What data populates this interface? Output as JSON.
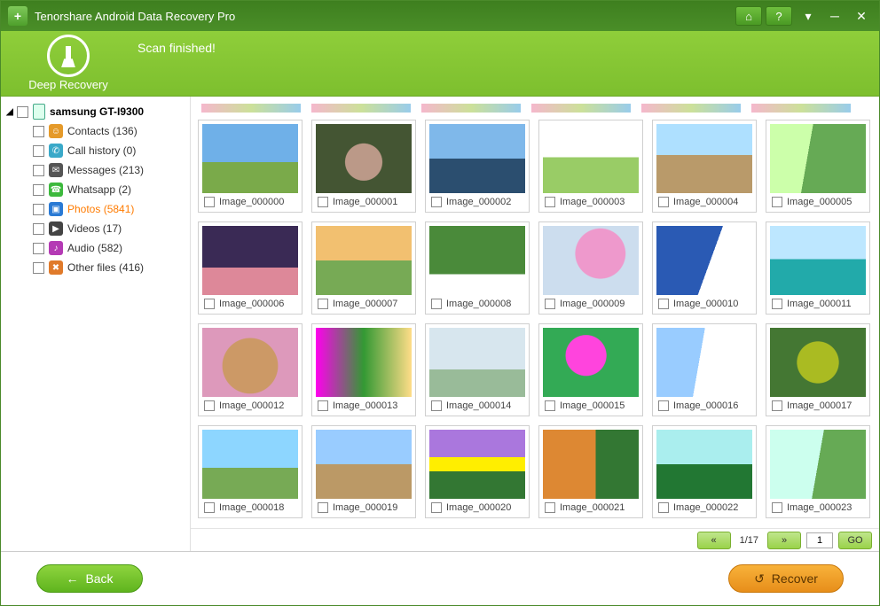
{
  "titlebar": {
    "app_title": "Tenorshare Android Data Recovery Pro"
  },
  "banner": {
    "deep_recovery_label": "Deep Recovery",
    "status": "Scan finished!"
  },
  "sidebar": {
    "device_name": "samsung GT-I9300",
    "categories": [
      {
        "key": "contacts",
        "label": "Contacts (136)",
        "selected": false
      },
      {
        "key": "callhist",
        "label": "Call history (0)",
        "selected": false
      },
      {
        "key": "messages",
        "label": "Messages (213)",
        "selected": false
      },
      {
        "key": "whatsapp",
        "label": "Whatsapp (2)",
        "selected": false
      },
      {
        "key": "photos",
        "label": "Photos (5841)",
        "selected": true
      },
      {
        "key": "videos",
        "label": "Videos (17)",
        "selected": false
      },
      {
        "key": "audio",
        "label": "Audio (582)",
        "selected": false
      },
      {
        "key": "other",
        "label": "Other files (416)",
        "selected": false
      }
    ]
  },
  "grid": {
    "items": [
      {
        "name": "Image_000000"
      },
      {
        "name": "Image_000001"
      },
      {
        "name": "Image_000002"
      },
      {
        "name": "Image_000003"
      },
      {
        "name": "Image_000004"
      },
      {
        "name": "Image_000005"
      },
      {
        "name": "Image_000006"
      },
      {
        "name": "Image_000007"
      },
      {
        "name": "Image_000008"
      },
      {
        "name": "Image_000009"
      },
      {
        "name": "Image_000010"
      },
      {
        "name": "Image_000011"
      },
      {
        "name": "Image_000012"
      },
      {
        "name": "Image_000013"
      },
      {
        "name": "Image_000014"
      },
      {
        "name": "Image_000015"
      },
      {
        "name": "Image_000016"
      },
      {
        "name": "Image_000017"
      },
      {
        "name": "Image_000018"
      },
      {
        "name": "Image_000019"
      },
      {
        "name": "Image_000020"
      },
      {
        "name": "Image_000021"
      },
      {
        "name": "Image_000022"
      },
      {
        "name": "Image_000023"
      }
    ]
  },
  "pager": {
    "prev_glyph": "«",
    "next_glyph": "»",
    "page_label": "1/17",
    "page_input": "1",
    "go_label": "GO"
  },
  "footer": {
    "back_label": "Back",
    "recover_label": "Recover"
  }
}
